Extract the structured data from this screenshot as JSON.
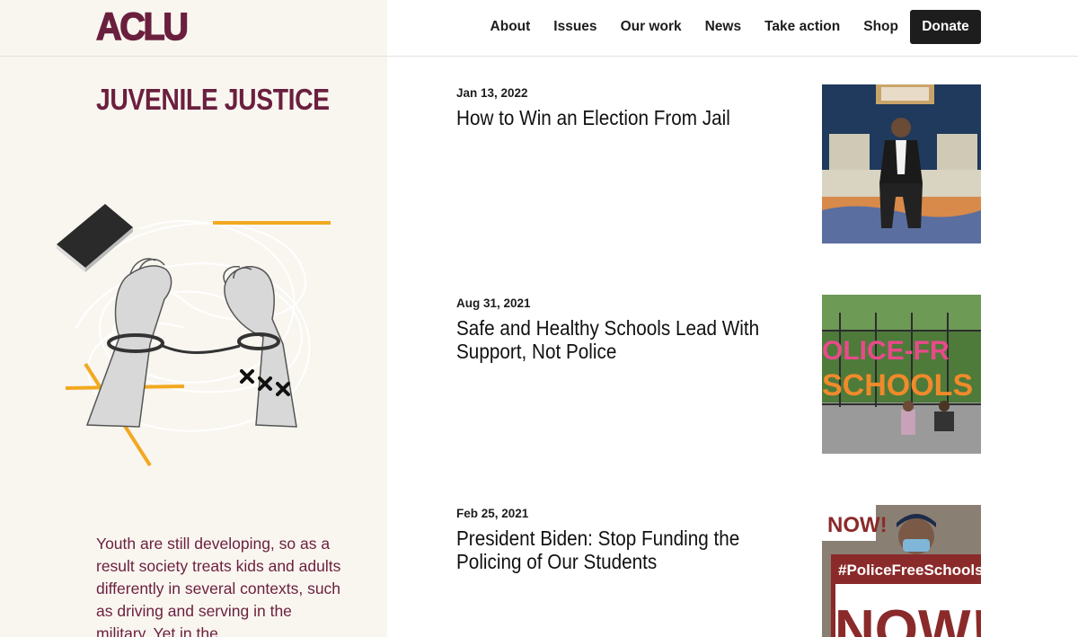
{
  "brand": {
    "logo": "ACLU",
    "color": "#6b1f3e"
  },
  "nav": {
    "items": [
      "About",
      "Issues",
      "Our work",
      "News",
      "Take action",
      "Shop"
    ],
    "donate_label": "Donate"
  },
  "sidebar": {
    "title": "JUVENILE JUSTICE",
    "intro": "Youth are still developing, so as a result society treats kids and adults differently in several contexts, such as driving and serving in the military. Yet in the"
  },
  "articles": [
    {
      "date": "Jan 13, 2022",
      "title": "How to Win an Election From Jail",
      "image": "man-seated-on-sofa-photo"
    },
    {
      "date": "Aug 31, 2021",
      "title": "Safe and Healthy Schools Lead With Support, Not Police",
      "image": "police-free-schools-fence-photo"
    },
    {
      "date": "Feb 25, 2021",
      "title": "President Biden: Stop Funding the Policing of Our Students",
      "image": "police-free-schools-protest-sign-photo"
    }
  ],
  "photo_text": {
    "fence_line1": "OLICE-FR",
    "fence_line2": "SCHOOLS",
    "sign_top": "NOW!",
    "sign_hashtag": "#PoliceFreeSchools",
    "sign_bottom": "NOW!"
  }
}
